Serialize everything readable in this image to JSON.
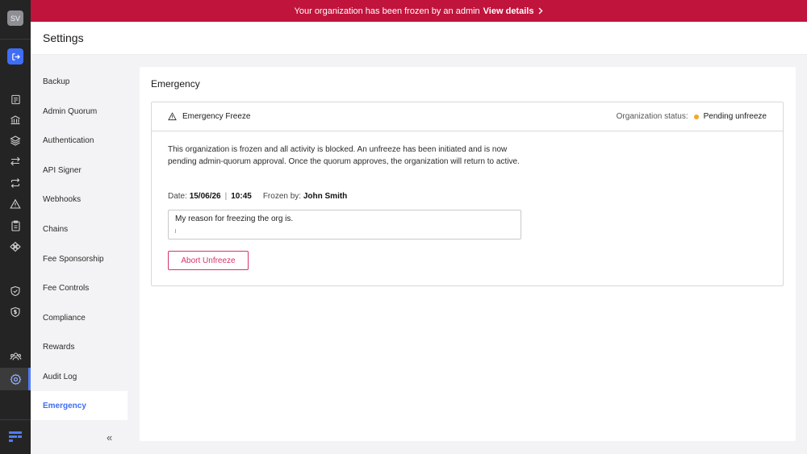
{
  "banner": {
    "message": "Your organization has been frozen by an admin",
    "link_label": "View details"
  },
  "rail": {
    "avatar_initials": "SV",
    "accent_color": "#3f6ef6",
    "icons": [
      "logout-icon",
      "report-icon",
      "bank-icon",
      "layers-icon",
      "transfer-icon",
      "repeat-icon",
      "warning-icon",
      "clipboard-icon",
      "nodes-icon",
      "shield-check-icon",
      "shield-dollar-icon",
      "users-icon",
      "settings-icon",
      "logo-icon"
    ]
  },
  "header": {
    "title": "Settings"
  },
  "nav": {
    "items": [
      {
        "label": "Backup"
      },
      {
        "label": "Admin Quorum"
      },
      {
        "label": "Authentication"
      },
      {
        "label": "API Signer"
      },
      {
        "label": "Webhooks"
      },
      {
        "label": "Chains"
      },
      {
        "label": "Fee Sponsorship"
      },
      {
        "label": "Fee Controls"
      },
      {
        "label": "Compliance"
      },
      {
        "label": "Rewards"
      },
      {
        "label": "Audit Log"
      },
      {
        "label": "Emergency"
      }
    ],
    "active": "Emergency",
    "collapse_glyph": "«"
  },
  "main": {
    "section_title": "Emergency",
    "card": {
      "heading": "Emergency Freeze",
      "status_label": "Organization status:",
      "status_value": "Pending unfreeze",
      "status_color": "#f5a623",
      "description": "This organization is frozen and all activity is blocked. An unfreeze has been initiated and is now pending admin-quorum approval. Once the quorum approves, the organization will return to active.",
      "date_label": "Date:",
      "date": "15/06/26",
      "time": "10:45",
      "frozen_by_label": "Frozen by:",
      "frozen_by": "John Smith",
      "reason_value": "My reason for freezing the org is.",
      "abort_label": "Abort Unfreeze",
      "abort_color": "#d6336c"
    }
  },
  "colors": {
    "banner": "#c0143c",
    "rail": "#242424",
    "active_nav": "#3d6ef0"
  }
}
